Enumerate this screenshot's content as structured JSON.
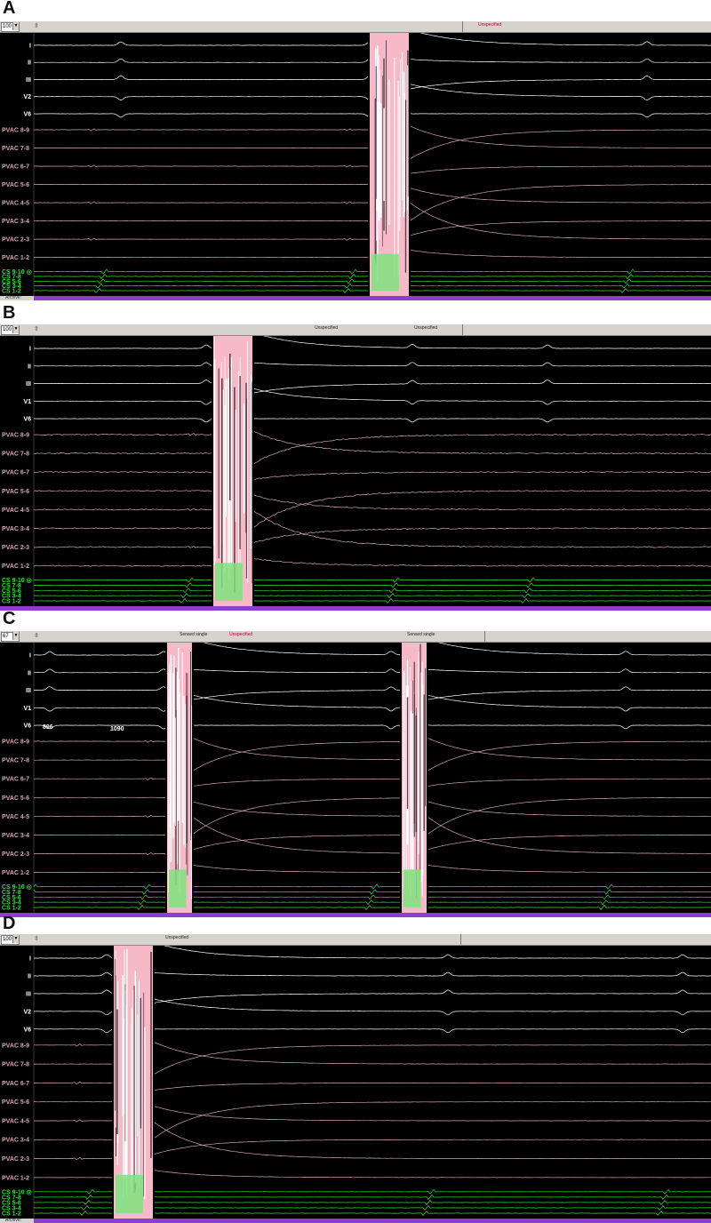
{
  "colors": {
    "background": "#000000",
    "surface": "#ffffff",
    "pvac": "#d4a6b0",
    "cs": "#33dd33",
    "artifact": "#f7b8c8",
    "artifact_green": "#7ee27e",
    "toolbar": "#d6d3ce",
    "status_strip": "#8a3fd0"
  },
  "chart_data": [
    {
      "type": "line",
      "panel": "A",
      "gain": "100",
      "markers": [
        {
          "label": "Unspecified",
          "x": 0.69,
          "color": "red"
        }
      ],
      "footer_label": "Archive:",
      "channels": [
        {
          "name": "I",
          "group": "surface"
        },
        {
          "name": "II",
          "group": "surface"
        },
        {
          "name": "III",
          "group": "surface"
        },
        {
          "name": "V2",
          "group": "surface"
        },
        {
          "name": "V6",
          "group": "surface"
        },
        {
          "name": "PVAC 8-9",
          "group": "pvac"
        },
        {
          "name": "PVAC 7-8",
          "group": "pvac"
        },
        {
          "name": "PVAC 6-7",
          "group": "pvac"
        },
        {
          "name": "PVAC 5-6",
          "group": "pvac"
        },
        {
          "name": "PVAC 4-5",
          "group": "pvac"
        },
        {
          "name": "PVAC 3-4",
          "group": "pvac"
        },
        {
          "name": "PVAC 2-3",
          "group": "pvac"
        },
        {
          "name": "PVAC 1-2",
          "group": "pvac"
        },
        {
          "name": "CS 9-10 ◎",
          "group": "cs"
        },
        {
          "name": "CS 7-8",
          "group": "cs"
        },
        {
          "name": "CS 5-6",
          "group": "cs"
        },
        {
          "name": "CS 3-4",
          "group": "cs"
        },
        {
          "name": "CS 1-2",
          "group": "cs"
        }
      ],
      "beats": [
        0.17,
        0.52,
        0.91
      ],
      "pvac_spikes": [
        0.13,
        0.49
      ],
      "ablation": [
        {
          "start": 0.52,
          "end": 0.575
        }
      ],
      "annotations": []
    },
    {
      "type": "line",
      "panel": "B",
      "gain": "100",
      "markers": [
        {
          "label": "Unspecified",
          "x": 0.46,
          "color": "dark"
        },
        {
          "label": "Unspecified",
          "x": 0.6,
          "color": "dark"
        }
      ],
      "footer_label": "",
      "channels": [
        {
          "name": "I",
          "group": "surface"
        },
        {
          "name": "II",
          "group": "surface"
        },
        {
          "name": "III",
          "group": "surface"
        },
        {
          "name": "V1",
          "group": "surface"
        },
        {
          "name": "V6",
          "group": "surface"
        },
        {
          "name": "PVAC 8-9",
          "group": "pvac"
        },
        {
          "name": "PVAC 7-8",
          "group": "pvac"
        },
        {
          "name": "PVAC 6-7",
          "group": "pvac"
        },
        {
          "name": "PVAC 5-6",
          "group": "pvac"
        },
        {
          "name": "PVAC 4-5",
          "group": "pvac"
        },
        {
          "name": "PVAC 3-4",
          "group": "pvac"
        },
        {
          "name": "PVAC 2-3",
          "group": "pvac"
        },
        {
          "name": "PVAC 1-2",
          "group": "pvac"
        },
        {
          "name": "CS 9-10 ◎",
          "group": "cs"
        },
        {
          "name": "CS 7-8",
          "group": "cs"
        },
        {
          "name": "CS 5-6",
          "group": "cs"
        },
        {
          "name": "CS 3-4",
          "group": "cs"
        },
        {
          "name": "CS 1-2",
          "group": "cs"
        }
      ],
      "beats": [
        0.29,
        0.58,
        0.77
      ],
      "pvac_spikes": [
        0.27
      ],
      "ablation": [
        {
          "start": 0.3,
          "end": 0.355
        }
      ],
      "annotations": []
    },
    {
      "type": "line",
      "panel": "C",
      "gain": "67",
      "markers": [
        {
          "label": "Sensed single",
          "x": 0.27,
          "color": "dark"
        },
        {
          "label": "Unspecified",
          "x": 0.34,
          "color": "red"
        },
        {
          "label": "Sensed single",
          "x": 0.59,
          "color": "dark"
        }
      ],
      "footer_label": "",
      "channels": [
        {
          "name": "I",
          "group": "surface"
        },
        {
          "name": "II",
          "group": "surface"
        },
        {
          "name": "III",
          "group": "surface"
        },
        {
          "name": "V1",
          "group": "surface"
        },
        {
          "name": "V6",
          "group": "surface"
        },
        {
          "name": "PVAC 8-9",
          "group": "pvac"
        },
        {
          "name": "PVAC 7-8",
          "group": "pvac"
        },
        {
          "name": "PVAC 6-7",
          "group": "pvac"
        },
        {
          "name": "PVAC 5-6",
          "group": "pvac"
        },
        {
          "name": "PVAC 4-5",
          "group": "pvac"
        },
        {
          "name": "PVAC 3-4",
          "group": "pvac"
        },
        {
          "name": "PVAC 2-3",
          "group": "pvac"
        },
        {
          "name": "PVAC 1-2",
          "group": "pvac"
        },
        {
          "name": "CS 9-10 ◎",
          "group": "cs"
        },
        {
          "name": "CS 7-8",
          "group": "cs"
        },
        {
          "name": "CS 5-6",
          "group": "cs"
        },
        {
          "name": "CS 3-4",
          "group": "cs"
        },
        {
          "name": "CS 1-2",
          "group": "cs"
        }
      ],
      "beats": [
        0.07,
        0.23,
        0.55,
        0.88
      ],
      "pvac_spikes": [
        0.21
      ],
      "ablation": [
        {
          "start": 0.235,
          "end": 0.27
        },
        {
          "start": 0.565,
          "end": 0.6
        }
      ],
      "annotations": [
        {
          "text": "896",
          "x": 0.06,
          "row": 4
        },
        {
          "text": "1090",
          "x": 0.155,
          "row": 4.2
        }
      ]
    },
    {
      "type": "line",
      "panel": "D",
      "gain": "100",
      "markers": [
        {
          "label": "Unspecified",
          "x": 0.25,
          "color": "dark"
        }
      ],
      "footer_label": "Archive:",
      "channels": [
        {
          "name": "I",
          "group": "surface"
        },
        {
          "name": "II",
          "group": "surface"
        },
        {
          "name": "III",
          "group": "surface"
        },
        {
          "name": "V2",
          "group": "surface"
        },
        {
          "name": "V6",
          "group": "surface"
        },
        {
          "name": "PVAC 8-9",
          "group": "pvac"
        },
        {
          "name": "PVAC 7-8",
          "group": "pvac"
        },
        {
          "name": "PVAC 6-7",
          "group": "pvac"
        },
        {
          "name": "PVAC 5-6",
          "group": "pvac"
        },
        {
          "name": "PVAC 4-5",
          "group": "pvac"
        },
        {
          "name": "PVAC 3-4",
          "group": "pvac"
        },
        {
          "name": "PVAC 2-3",
          "group": "pvac"
        },
        {
          "name": "PVAC 1-2",
          "group": "pvac"
        },
        {
          "name": "CS 9-10 ◎",
          "group": "cs"
        },
        {
          "name": "CS 7-8",
          "group": "cs"
        },
        {
          "name": "CS 5-6",
          "group": "cs"
        },
        {
          "name": "CS 3-4",
          "group": "cs"
        },
        {
          "name": "CS 1-2",
          "group": "cs"
        }
      ],
      "beats": [
        0.15,
        0.63,
        0.96
      ],
      "pvac_spikes": [
        0.11
      ],
      "ablation": [
        {
          "start": 0.16,
          "end": 0.215
        }
      ],
      "annotations": []
    }
  ]
}
